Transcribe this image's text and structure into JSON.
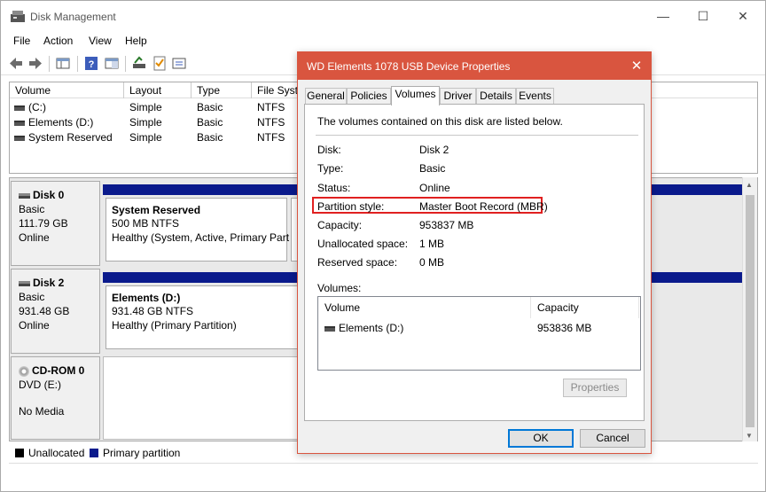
{
  "window": {
    "title": "Disk Management",
    "controls": {
      "minimize": "—",
      "maximize": "☐",
      "close": "✕"
    }
  },
  "menu": [
    "File",
    "Action",
    "View",
    "Help"
  ],
  "volume_list": {
    "columns": [
      "Volume",
      "Layout",
      "Type",
      "File Syste"
    ],
    "rows": [
      {
        "volume": "(C:)",
        "layout": "Simple",
        "type": "Basic",
        "fs": "NTFS"
      },
      {
        "volume": "Elements (D:)",
        "layout": "Simple",
        "type": "Basic",
        "fs": "NTFS"
      },
      {
        "volume": "System Reserved",
        "layout": "Simple",
        "type": "Basic",
        "fs": "NTFS"
      }
    ]
  },
  "disks": [
    {
      "name": "Disk 0",
      "type": "Basic",
      "size": "111.79 GB",
      "status": "Online",
      "partition": {
        "name": "System Reserved",
        "size": "500 MB NTFS",
        "status": "Healthy (System, Active, Primary Part"
      }
    },
    {
      "name": "Disk 2",
      "type": "Basic",
      "size": "931.48 GB",
      "status": "Online",
      "partition": {
        "name": "Elements  (D:)",
        "size": "931.48 GB NTFS",
        "status": "Healthy (Primary Partition)"
      }
    },
    {
      "name": "CD-ROM 0",
      "type": "DVD (E:)",
      "size": "",
      "status": "No Media"
    }
  ],
  "legend": [
    {
      "label": "Unallocated",
      "color": "#000000"
    },
    {
      "label": "Primary partition",
      "color": "#0a1a8c"
    }
  ],
  "dialog": {
    "title": "WD Elements 1078 USB Device Properties",
    "close": "✕",
    "tabs": [
      "General",
      "Policies",
      "Volumes",
      "Driver",
      "Details",
      "Events"
    ],
    "active_tab": "Volumes",
    "intro": "The volumes contained on this disk are listed below.",
    "props": [
      {
        "k": "Disk:",
        "v": "Disk 2"
      },
      {
        "k": "Type:",
        "v": "Basic"
      },
      {
        "k": "Status:",
        "v": "Online"
      },
      {
        "k": "Partition style:",
        "v": "Master Boot Record (MBR)"
      },
      {
        "k": "Capacity:",
        "v": "953837 MB"
      },
      {
        "k": "Unallocated space:",
        "v": "1 MB"
      },
      {
        "k": "Reserved space:",
        "v": "0 MB"
      }
    ],
    "volumes_label": "Volumes:",
    "volumes_table": {
      "columns": [
        "Volume",
        "Capacity"
      ],
      "rows": [
        {
          "volume": "Elements (D:)",
          "capacity": "953836 MB"
        }
      ]
    },
    "properties_button": "Properties",
    "ok_button": "OK",
    "cancel_button": "Cancel",
    "highlight_color": "#e02020",
    "title_color": "#d9553f"
  }
}
